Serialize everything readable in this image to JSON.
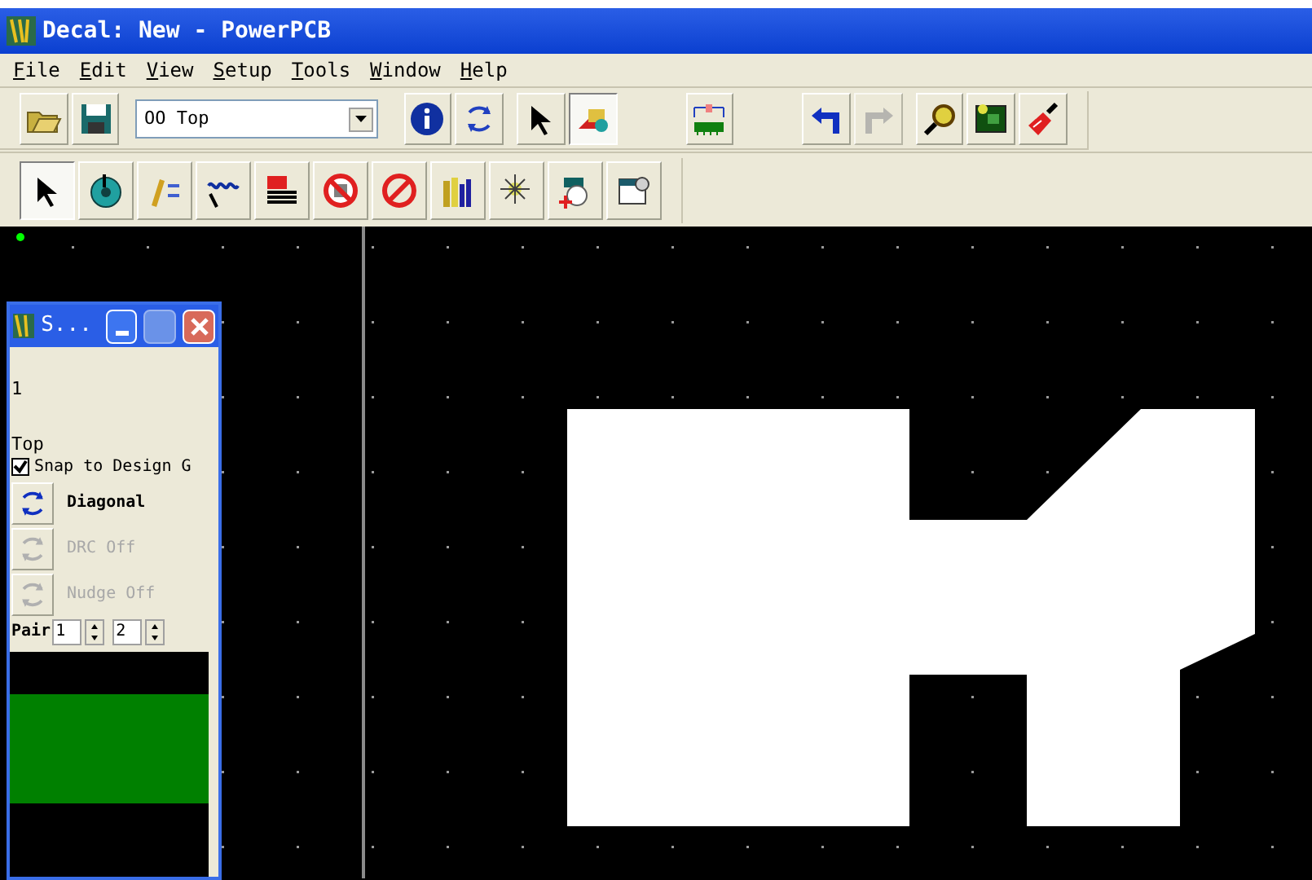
{
  "window": {
    "title": "Decal: New - PowerPCB"
  },
  "menu": [
    {
      "label": "File"
    },
    {
      "label": "Edit"
    },
    {
      "label": "View"
    },
    {
      "label": "Setup"
    },
    {
      "label": "Tools"
    },
    {
      "label": "Window"
    },
    {
      "label": "Help"
    }
  ],
  "toolbar_1": {
    "layer_dropdown": {
      "value": "OO Top"
    },
    "buttons": [
      {
        "kind": "open",
        "pressed": false,
        "disabled": false
      },
      {
        "kind": "save",
        "pressed": false,
        "disabled": false
      },
      {
        "kind": "layer",
        "pressed": false,
        "disabled": false
      },
      {
        "kind": "info",
        "pressed": false,
        "disabled": false
      },
      {
        "kind": "cycle",
        "pressed": false,
        "disabled": false
      },
      {
        "kind": "select",
        "pressed": false,
        "disabled": false
      },
      {
        "kind": "decal",
        "pressed": true,
        "disabled": false
      },
      {
        "kind": "board",
        "pressed": false,
        "disabled": false
      },
      {
        "kind": "undo",
        "pressed": false,
        "disabled": false
      },
      {
        "kind": "redo",
        "pressed": false,
        "disabled": true
      },
      {
        "kind": "zoom",
        "pressed": false,
        "disabled": false
      },
      {
        "kind": "chip",
        "pressed": false,
        "disabled": false
      },
      {
        "kind": "brush",
        "pressed": false,
        "disabled": false
      }
    ]
  },
  "toolbar_2": {
    "buttons": [
      {
        "kind": "select",
        "pressed": true
      },
      {
        "kind": "disc",
        "pressed": false
      },
      {
        "kind": "pencil",
        "pressed": false
      },
      {
        "kind": "text",
        "pressed": false
      },
      {
        "kind": "lines",
        "pressed": false
      },
      {
        "kind": "forbid2",
        "pressed": false
      },
      {
        "kind": "forbid",
        "pressed": false
      },
      {
        "kind": "bars",
        "pressed": false
      },
      {
        "kind": "spark",
        "pressed": false
      },
      {
        "kind": "wizard",
        "pressed": false
      },
      {
        "kind": "window",
        "pressed": false
      }
    ]
  },
  "floating_panel": {
    "title": "S...",
    "line_1": "1",
    "layer": "Top",
    "snap": {
      "label": "Snap to Design G",
      "checked": true
    },
    "toggles": [
      {
        "label": "Diagonal",
        "disabled": false
      },
      {
        "label": "DRC Off",
        "disabled": true
      },
      {
        "label": "Nudge Off",
        "disabled": true
      }
    ],
    "pair": {
      "label": "Pair",
      "value_1": "1",
      "value_2": "2"
    }
  }
}
